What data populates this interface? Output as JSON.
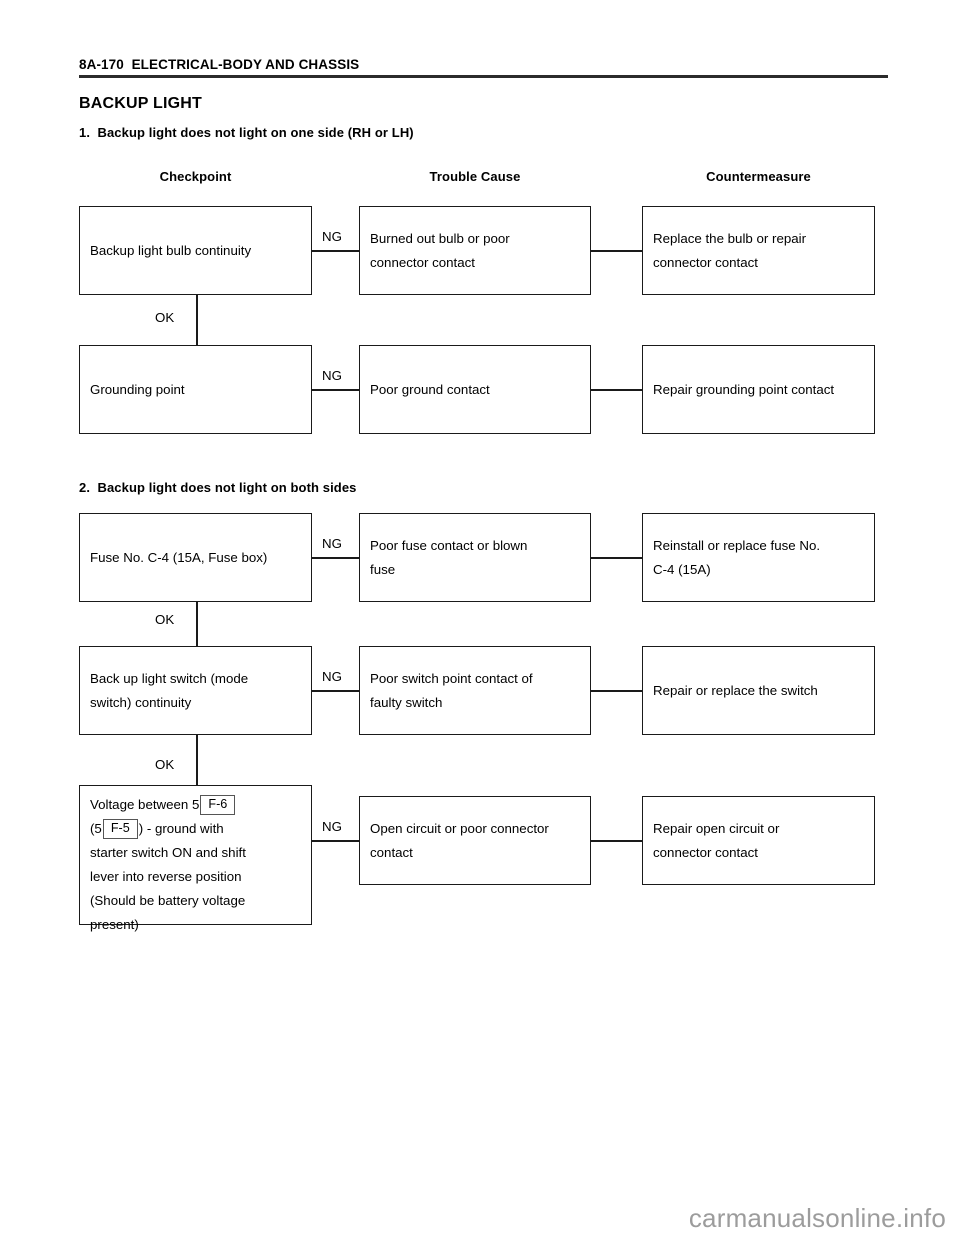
{
  "header": {
    "page_code": "8A-170",
    "section_name": "ELECTRICAL-BODY AND CHASSIS",
    "full_text": "8A-170  ELECTRICAL-BODY AND CHASSIS"
  },
  "doc_title": "BACKUP LIGHT",
  "columns": {
    "checkpoint": "Checkpoint",
    "trouble_cause": "Trouble Cause",
    "countermeasure": "Countermeasure"
  },
  "labels": {
    "ng": "NG",
    "ok": "OK"
  },
  "sections": [
    {
      "heading": "1.  Backup light does not light on one side (RH or LH)",
      "rows": [
        {
          "checkpoint": "Backup light bulb continuity",
          "branch": "NG",
          "trouble_cause_line1": "Burned out bulb or poor",
          "trouble_cause_line2": "connector contact",
          "countermeasure_line1": "Replace the bulb or repair",
          "countermeasure_line2": "connector contact",
          "pass": "OK"
        },
        {
          "checkpoint": "Grounding point",
          "branch": "NG",
          "trouble_cause_line1": "Poor ground contact",
          "trouble_cause_line2": "",
          "countermeasure_line1": "Repair grounding point contact",
          "countermeasure_line2": "",
          "pass": ""
        }
      ]
    },
    {
      "heading": "2.  Backup light does not light on both sides",
      "rows": [
        {
          "checkpoint": "Fuse No. C-4 (15A, Fuse box)",
          "branch": "NG",
          "trouble_cause_line1": "Poor fuse contact or blown",
          "trouble_cause_line2": "fuse",
          "countermeasure_line1": "Reinstall or replace fuse No.",
          "countermeasure_line2": "C-4 (15A)",
          "pass": "OK"
        },
        {
          "checkpoint_line1": "Back up light switch (mode",
          "checkpoint_line2": "switch) continuity",
          "branch": "NG",
          "trouble_cause_line1": "Poor switch point contact of",
          "trouble_cause_line2": "faulty switch",
          "countermeasure_line1": "Repair or replace the switch",
          "countermeasure_line2": "",
          "pass": "OK"
        },
        {
          "voltage_check": {
            "l1_pre": "Voltage between 5",
            "l1_chip": "F-6",
            "l2_pre": "(5",
            "l2_chip": "F-5",
            "l2_post": ") - ground with",
            "l3": "starter switch ON and shift",
            "l4": "lever into reverse position",
            "l5": "(Should be battery voltage",
            "l6": "present)"
          },
          "branch": "NG",
          "trouble_cause_line1": "Open circuit or poor connector",
          "trouble_cause_line2": "contact",
          "countermeasure_line1": "Repair open circuit or",
          "countermeasure_line2": "connector contact",
          "pass": ""
        }
      ]
    }
  ],
  "watermark": "carmanualsonline.info"
}
